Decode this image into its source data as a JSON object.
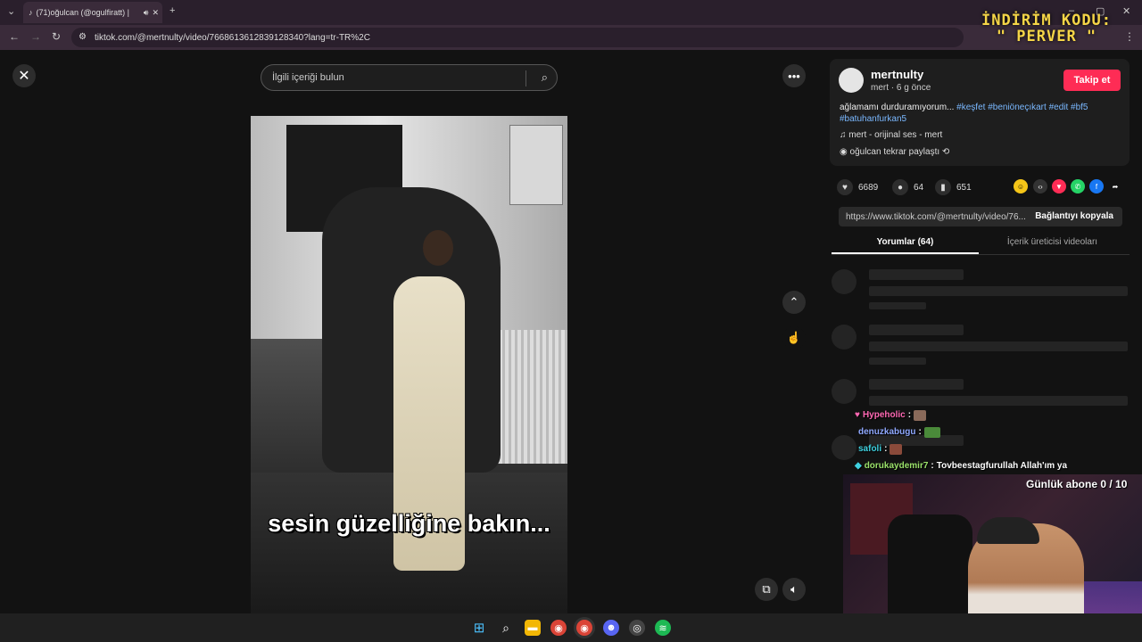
{
  "browser": {
    "tab_title": "(71)oğulcan (@ogulfiratt) |",
    "new_tab": "+",
    "url": "tiktok.com/@mertnulty/video/7668613612839128340?lang=tr-TR%2C",
    "promo_line1": "İNDİRİM KODU:",
    "promo_line2": "\" PERVER \""
  },
  "search": {
    "placeholder": "İlgili içeriği bulun"
  },
  "video": {
    "caption": "sesin güzelliğine bakın..."
  },
  "post": {
    "username": "mertnulty",
    "subline": "mert · 6 g önce",
    "follow_label": "Takip et",
    "description": "ağlamamı durduramıyorum...",
    "hashtags": "#keşfet #beniöneçıkart #edit #bf5",
    "hashtags2": "#batuhanfurkan5",
    "music": "mert - orijinal ses - mert",
    "repost": "oğulcan tekrar paylaştı",
    "likes": "6689",
    "comments": "64",
    "saves": "651",
    "link": "https://www.tiktok.com/@mertnulty/video/76...",
    "copy_link": "Bağlantıyı kopyala",
    "tab_comments": "Yorumlar (64)",
    "tab_creator": "İçerik üreticisi videoları"
  },
  "chat": [
    {
      "name": "Hypeholic",
      "color": "#ff69b4",
      "message": "",
      "emote": "#8a6a5a"
    },
    {
      "name": "denuzkabugu",
      "color": "#8fa8ff",
      "message": "",
      "emote": "#4a8a3a"
    },
    {
      "name": "safoli",
      "color": "#3fd1e0",
      "message": "",
      "emote": "#8a4a3a"
    },
    {
      "name": "dorukaydemir7",
      "color": "#9be26a",
      "message": "Tovbeestagfurullah Allah'ım ya",
      "emote": ""
    }
  ],
  "stream": {
    "sub_goal": "Günlük abone 0 / 10"
  },
  "colors": {
    "accent": "#fe2c55",
    "hashtag": "#7ab8ff"
  }
}
